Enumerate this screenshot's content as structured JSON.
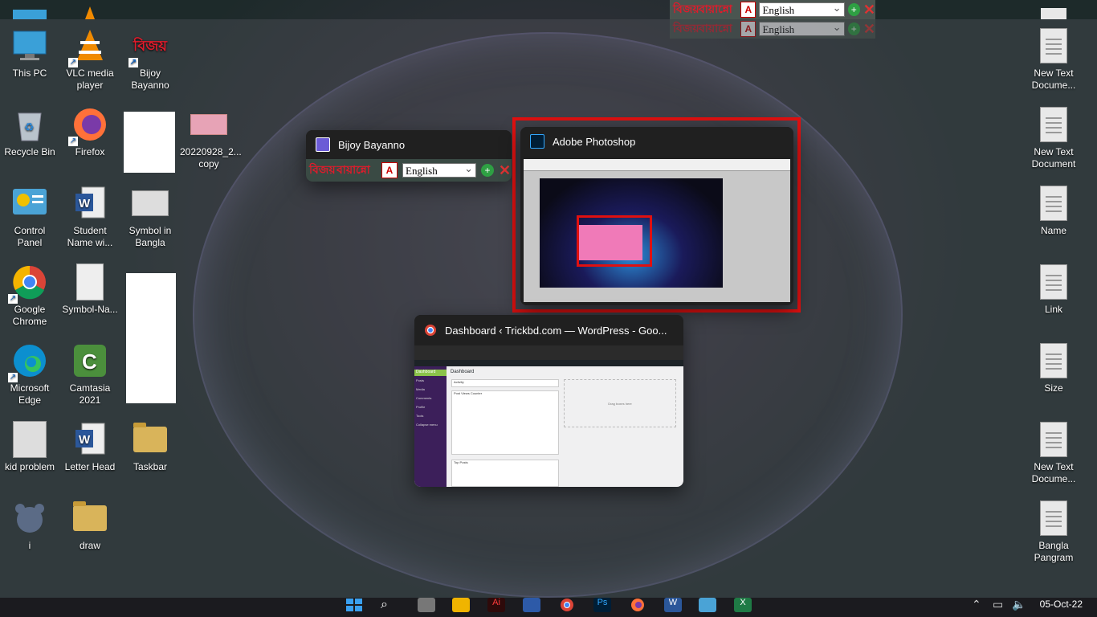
{
  "desktop_left": [
    {
      "label": "This PC",
      "icon": "monitor-icon"
    },
    {
      "label": "VLC media player",
      "icon": "vlc-icon"
    },
    {
      "label": "Bijoy Bayanno",
      "icon": "bijoy-icon"
    },
    {
      "label": "Recycle Bin",
      "icon": "recycle-bin-icon"
    },
    {
      "label": "Firefox",
      "icon": "firefox-icon"
    },
    {
      "label": "20220928_2... copy",
      "icon": "image-file-icon"
    },
    {
      "label": "Control Panel",
      "icon": "control-panel-icon"
    },
    {
      "label": "Student Name wi...",
      "icon": "word-icon"
    },
    {
      "label": "Symbol in Bangla",
      "icon": "image-file-icon"
    },
    {
      "label": "Google Chrome",
      "icon": "chrome-icon"
    },
    {
      "label": "Symbol-Na...",
      "icon": "image-file-icon"
    },
    {
      "label": "Microsoft Edge",
      "icon": "edge-icon"
    },
    {
      "label": "Camtasia 2021",
      "icon": "camtasia-icon"
    },
    {
      "label": "kid problem",
      "icon": "image-file-icon"
    },
    {
      "label": "Letter Head",
      "icon": "word-icon"
    },
    {
      "label": "Taskbar",
      "icon": "folder-icon"
    },
    {
      "label": "i",
      "icon": "grizzly-icon"
    },
    {
      "label": "draw",
      "icon": "folder-icon"
    }
  ],
  "desktop_right": [
    {
      "label": "New Text Docume..."
    },
    {
      "label": "New Text Document"
    },
    {
      "label": "Name"
    },
    {
      "label": "Link"
    },
    {
      "label": "Size"
    },
    {
      "label": "New Text Docume..."
    },
    {
      "label": "Bangla Pangram"
    }
  ],
  "bijoy_bar": {
    "logo": "বিজয়",
    "name": "বায়ান্নো",
    "language": "English"
  },
  "alt_tab": {
    "windows": [
      {
        "title": "Bijoy Bayanno",
        "selected": false
      },
      {
        "title": "Adobe Photoshop",
        "selected": true
      },
      {
        "title": "Dashboard ‹ Trickbd.com — WordPress - Goo...",
        "selected": false
      }
    ]
  },
  "wp_preview": {
    "page_title": "Dashboard",
    "menu": [
      "Dashboard",
      "Posts",
      "Media",
      "Comments",
      "Profile",
      "Tools",
      "Collapse menu"
    ],
    "widgets": [
      "Activity",
      "Post Views Counter",
      "Top Posts"
    ],
    "drop_text": "Drag boxes here"
  },
  "taskbar": {
    "clock": "05-Oct-22"
  }
}
